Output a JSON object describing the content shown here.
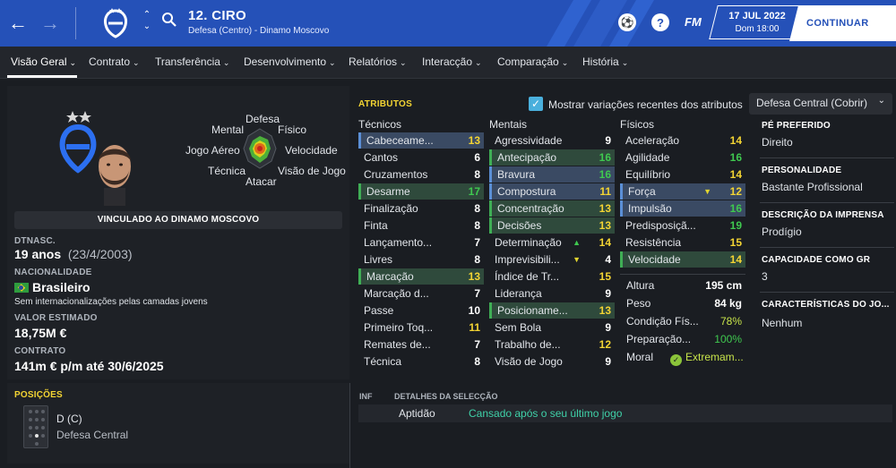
{
  "header": {
    "player_name": "12. CIRO",
    "player_sub": "Defesa (Centro) - Dinamo Moscovo",
    "fm_label": "FM",
    "date": "17 JUL 2022",
    "time": "Dom 18:00",
    "continue_label": "CONTINUAR"
  },
  "tabs": [
    {
      "label": "Visão Geral"
    },
    {
      "label": "Contrato"
    },
    {
      "label": "Transferência"
    },
    {
      "label": "Desenvolvimento"
    },
    {
      "label": "Relatórios"
    },
    {
      "label": "Interacção"
    },
    {
      "label": "Comparação"
    },
    {
      "label": "História"
    }
  ],
  "profile": {
    "radar_labels": {
      "defesa": "Defesa",
      "fisico": "Físico",
      "mental": "Mental",
      "velocidade": "Velocidade",
      "jogo_aereo": "Jogo Aéreo",
      "visao_de_jogo": "Visão de Jogo",
      "tecnica": "Técnica",
      "atacar": "Atacar"
    },
    "contract_banner": "VINCULADO AO DINAMO MOSCOVO",
    "dob_label": "DTNASC.",
    "age": "19 anos",
    "dob": "(23/4/2003)",
    "nationality_label": "NACIONALIDADE",
    "nationality": "Brasileiro",
    "international_note": "Sem internacionalizações pelas camadas jovens",
    "value_label": "VALOR ESTIMADO",
    "value": "18,75M €",
    "contract_label": "CONTRATO",
    "contract": "141m € p/m até 30/6/2025"
  },
  "attributes": {
    "header": "ATRIBUTOS",
    "show_changes_label": "Mostrar variações recentes dos atributos",
    "show_changes_checked": true,
    "role_select": "Defesa Central (Cobrir)",
    "technical_title": "Técnicos",
    "mental_title": "Mentais",
    "physical_title": "Físicos",
    "technical": [
      {
        "name": "Cabeceame...",
        "value": "13",
        "hl": "blue"
      },
      {
        "name": "Cantos",
        "value": "6",
        "hl": ""
      },
      {
        "name": "Cruzamentos",
        "value": "8",
        "hl": ""
      },
      {
        "name": "Desarme",
        "value": "17",
        "hl": "green"
      },
      {
        "name": "Finalização",
        "value": "8",
        "hl": ""
      },
      {
        "name": "Finta",
        "value": "8",
        "hl": ""
      },
      {
        "name": "Lançamento...",
        "value": "7",
        "hl": ""
      },
      {
        "name": "Livres",
        "value": "8",
        "hl": ""
      },
      {
        "name": "Marcação",
        "value": "13",
        "hl": "green"
      },
      {
        "name": "Marcação d...",
        "value": "7",
        "hl": ""
      },
      {
        "name": "Passe",
        "value": "10",
        "hl": ""
      },
      {
        "name": "Primeiro Toq...",
        "value": "11",
        "hl": ""
      },
      {
        "name": "Remates de...",
        "value": "7",
        "hl": ""
      },
      {
        "name": "Técnica",
        "value": "8",
        "hl": ""
      }
    ],
    "mental": [
      {
        "name": "Agressividade",
        "value": "9",
        "hl": ""
      },
      {
        "name": "Antecipação",
        "value": "16",
        "hl": "green"
      },
      {
        "name": "Bravura",
        "value": "16",
        "hl": "blue"
      },
      {
        "name": "Compostura",
        "value": "11",
        "hl": "blue"
      },
      {
        "name": "Concentração",
        "value": "13",
        "hl": "green"
      },
      {
        "name": "Decisões",
        "value": "13",
        "hl": "green"
      },
      {
        "name": "Determinação",
        "value": "14",
        "hl": "",
        "change": "up"
      },
      {
        "name": "Imprevisibili...",
        "value": "4",
        "hl": "",
        "change": "down"
      },
      {
        "name": "Índice de Tr...",
        "value": "15",
        "hl": ""
      },
      {
        "name": "Liderança",
        "value": "9",
        "hl": ""
      },
      {
        "name": "Posicioname...",
        "value": "13",
        "hl": "green"
      },
      {
        "name": "Sem Bola",
        "value": "9",
        "hl": ""
      },
      {
        "name": "Trabalho de...",
        "value": "12",
        "hl": ""
      },
      {
        "name": "Visão de Jogo",
        "value": "9",
        "hl": ""
      }
    ],
    "physical": [
      {
        "name": "Aceleração",
        "value": "14",
        "hl": ""
      },
      {
        "name": "Agilidade",
        "value": "16",
        "hl": ""
      },
      {
        "name": "Equilíbrio",
        "value": "14",
        "hl": ""
      },
      {
        "name": "Força",
        "value": "12",
        "hl": "blue",
        "change": "down"
      },
      {
        "name": "Impulsão",
        "value": "16",
        "hl": "blue"
      },
      {
        "name": "Predisposiçã...",
        "value": "19",
        "hl": ""
      },
      {
        "name": "Resistência",
        "value": "15",
        "hl": ""
      },
      {
        "name": "Velocidade",
        "value": "14",
        "hl": "green"
      }
    ],
    "height_label": "Altura",
    "height": "195 cm",
    "weight_label": "Peso",
    "weight": "84 kg",
    "condition_label": "Condição Fís...",
    "condition": "78%",
    "preparation_label": "Preparação...",
    "preparation": "100%",
    "morale_label": "Moral",
    "morale": "Extremam..."
  },
  "info": {
    "foot_label": "PÉ PREFERIDO",
    "foot": "Direito",
    "personality_label": "PERSONALIDADE",
    "personality": "Bastante Profissional",
    "press_label": "DESCRIÇÃO DA IMPRENSA",
    "press": "Prodígio",
    "gk_label": "CAPACIDADE COMO GR",
    "gk": "3",
    "traits_label": "CARACTERÍSTICAS DO JO...",
    "traits": "Nenhum"
  },
  "positions": {
    "title": "POSIÇÕES",
    "code": "D (C)",
    "role": "Defesa Central"
  },
  "details": {
    "inf": "INF",
    "title": "DETALHES DA SELECÇÃO",
    "aptidao_label": "Aptidão",
    "aptidao_value": "Cansado após o seu último jogo"
  },
  "colors": {
    "header_blue": "#2551b8",
    "attr_yellow": "#f3d433",
    "attr_green": "#3fc84f",
    "attr_teal": "#3fd1a8"
  }
}
